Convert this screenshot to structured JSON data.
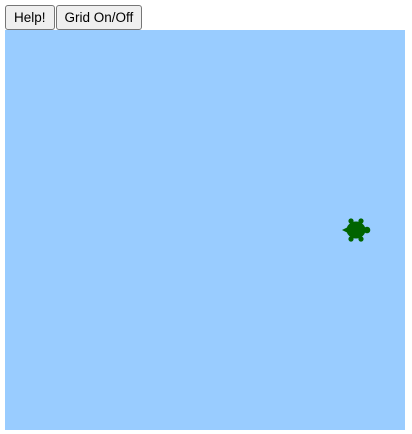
{
  "toolbar": {
    "help_label": "Help!",
    "grid_label": "Grid On/Off"
  },
  "canvas": {
    "background_color": "#99ccff",
    "grid_visible": false
  },
  "turtle": {
    "icon": "turtle-icon",
    "color": "#006400",
    "heading": "west"
  }
}
